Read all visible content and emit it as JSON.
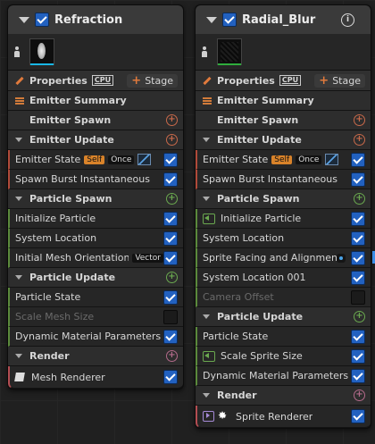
{
  "emitters": [
    {
      "title": "Refraction",
      "thumb_bar_color": "#19b7e6",
      "properties": {
        "label": "Properties",
        "sim_target": "CPU",
        "stage_button": "Stage"
      },
      "summary_label": "Emitter Summary",
      "emitter_spawn": "Emitter Spawn",
      "emitter_update": "Emitter Update",
      "emitter_state": {
        "label": "Emitter State",
        "tag_self": "Self",
        "tag_once": "Once"
      },
      "spawn_burst": "Spawn Burst Instantaneous",
      "particle_spawn": "Particle Spawn",
      "ps_items": [
        "Initialize Particle",
        "System Location",
        "Initial Mesh Orientation"
      ],
      "ps_tag": "Vector",
      "particle_update": "Particle Update",
      "pu_items": [
        "Particle State",
        "Scale Mesh Size",
        "Dynamic Material Parameters"
      ],
      "render": "Render",
      "renderer": "Mesh Renderer"
    },
    {
      "title": "Radial_Blur",
      "thumb_bar_color": "#2fae3c",
      "properties": {
        "label": "Properties",
        "sim_target": "CPU",
        "stage_button": "Stage"
      },
      "summary_label": "Emitter Summary",
      "emitter_spawn": "Emitter Spawn",
      "emitter_update": "Emitter Update",
      "emitter_state": {
        "label": "Emitter State",
        "tag_self": "Self",
        "tag_once": "Once"
      },
      "spawn_burst": "Spawn Burst Instantaneous",
      "particle_spawn": "Particle Spawn",
      "ps_items": [
        "Initialize Particle",
        "System Location",
        "Sprite Facing and Alignment",
        "System Location 001",
        "Camera Offset"
      ],
      "particle_update": "Particle Update",
      "pu_items": [
        "Particle State",
        "Scale Sprite Size",
        "Dynamic Material Parameters"
      ],
      "render": "Render",
      "renderer": "Sprite Renderer"
    }
  ]
}
